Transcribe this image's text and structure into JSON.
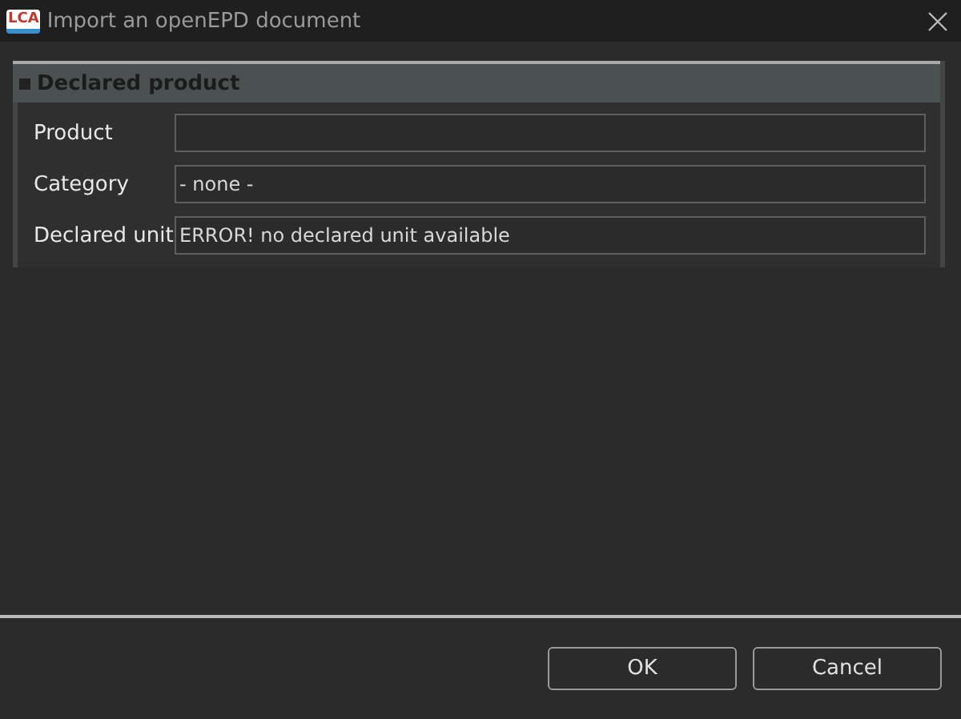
{
  "window": {
    "title": "Import an openEPD document",
    "logo": "LCA"
  },
  "section": {
    "title": "Declared product",
    "expanded": true,
    "fields": [
      {
        "label": "Product"
      },
      {
        "label": "Category",
        "value": "- none -"
      },
      {
        "label": "Declared unit",
        "value": "ERROR! no declared unit available"
      }
    ]
  },
  "buttons": [
    "OK",
    "Cancel"
  ]
}
